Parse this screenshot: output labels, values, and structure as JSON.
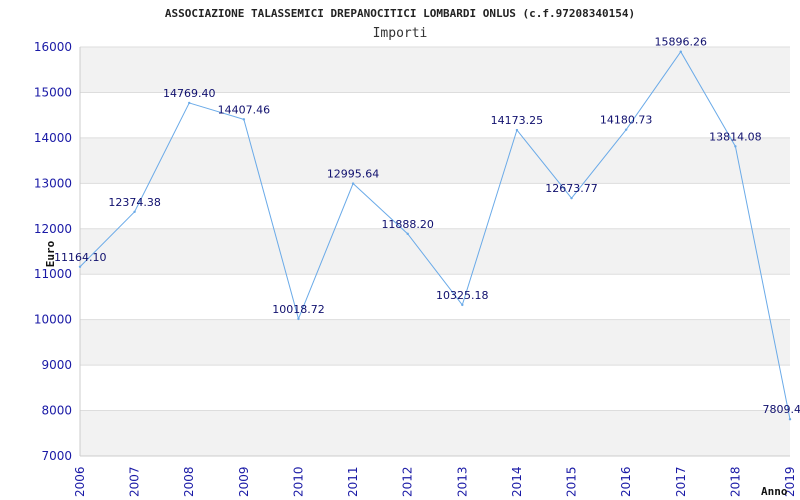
{
  "chart_data": {
    "type": "line",
    "title": "ASSOCIAZIONE TALASSEMICI DREPANOCITICI LOMBARDI ONLUS (c.f.97208340154)",
    "subtitle": "Importi",
    "xlabel": "Anno",
    "ylabel": "Euro",
    "ylim": [
      7000,
      16000
    ],
    "y_ticks": [
      7000,
      8000,
      9000,
      10000,
      11000,
      12000,
      13000,
      14000,
      15000,
      16000
    ],
    "grid": true,
    "legend": "none",
    "categories": [
      "2006",
      "2007",
      "2008",
      "2009",
      "2010",
      "2011",
      "2012",
      "2013",
      "2014",
      "2015",
      "2016",
      "2017",
      "2018",
      "2019"
    ],
    "values": [
      11164.1,
      12374.38,
      14769.4,
      14407.46,
      10018.72,
      12995.64,
      11888.2,
      10325.18,
      14173.25,
      12673.77,
      14180.73,
      15896.26,
      13814.08,
      7809.4
    ],
    "value_labels": [
      "11164.10",
      "12374.38",
      "14769.40",
      "14407.46",
      "10018.72",
      "12995.64",
      "11888.20",
      "10325.18",
      "14173.25",
      "12673.77",
      "14180.73",
      "15896.26",
      "13814.08",
      "7809.4"
    ],
    "line_color": "#6aaae8",
    "band_color": "#f2f2f2",
    "tick_color": "#1a1aa6",
    "label_color": "#10106e"
  }
}
